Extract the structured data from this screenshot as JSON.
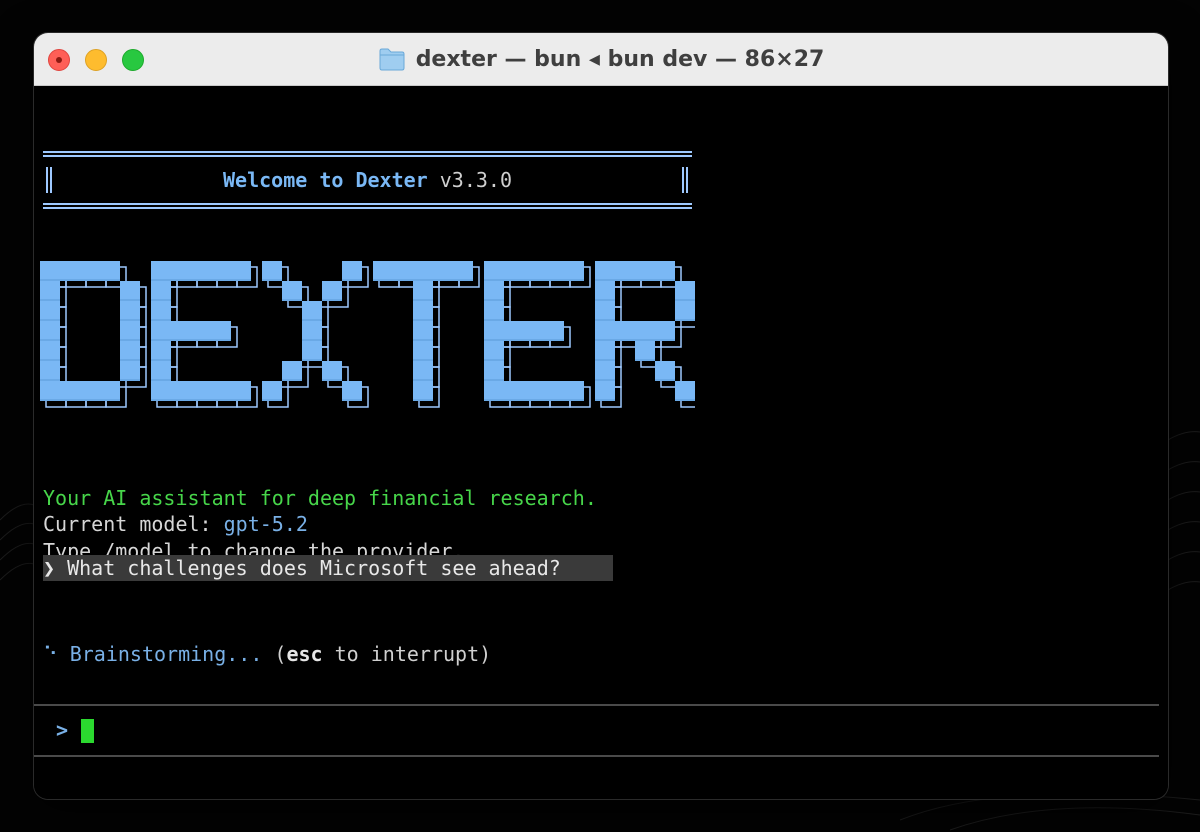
{
  "window": {
    "title": "dexter — bun ◂ bun dev — 86×27",
    "folder_icon": "folder-icon",
    "controls": [
      "close",
      "minimize",
      "zoom"
    ]
  },
  "terminal": {
    "banner": {
      "welcome_text": "Welcome to Dexter",
      "version": "v3.3.0"
    },
    "logo_text": "DEXTER",
    "tagline": "Your AI assistant for deep financial research.",
    "model_label": "Current model: ",
    "model_value": "gpt-5.2",
    "hint": "Type /model to change the provider.",
    "query_marker": "❯",
    "query": "What challenges does Microsoft see ahead?",
    "status": {
      "spinner": "⠑",
      "text": "Brainstorming...",
      "paren_open": " (",
      "key": "esc",
      "paren_rest": " to interrupt)"
    },
    "prompt_symbol": ">",
    "input_value": ""
  },
  "colors": {
    "accent_blue": "#7ab8f5",
    "tagline_green": "#47d64a",
    "cursor_green": "#2bd92f",
    "query_bg": "#3a3a3a"
  }
}
